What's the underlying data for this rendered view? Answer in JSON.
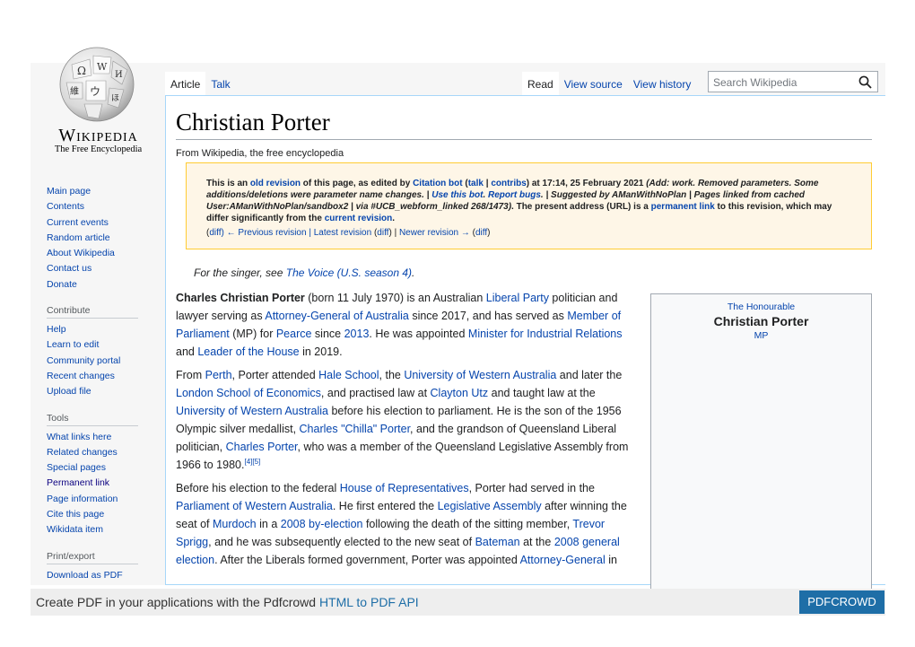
{
  "logo": {
    "wordmark": "Wikipedia",
    "tagline": "The Free Encyclopedia"
  },
  "tabs_left": [
    {
      "label": "Article",
      "selected": true
    },
    {
      "label": "Talk",
      "selected": false
    }
  ],
  "tabs_right": [
    {
      "label": "Read",
      "selected": true
    },
    {
      "label": "View source",
      "selected": false
    },
    {
      "label": "View history",
      "selected": false
    }
  ],
  "search": {
    "placeholder": "Search Wikipedia",
    "icon": "search-icon"
  },
  "title": "Christian Porter",
  "from": "From Wikipedia, the free encyclopedia",
  "notice": {
    "p1": "This is an ",
    "old_revision": "old revision",
    "p2": " of this page, as edited by ",
    "editor": "Citation bot",
    "p3": " (",
    "talk": "talk",
    "sep": " | ",
    "contribs": "contribs",
    "p4": ") at 17:14, 25 February 2021 ",
    "summary1": "(Add: work. Removed parameters. Some additions/deletions were parameter name changes. | ",
    "use_bot": "Use this bot",
    "dot": ". ",
    "report_bugs": "Report bugs",
    "summary2": ". | Suggested by AManWithNoPlan | Pages linked from cached User:AManWithNoPlan/sandbox2 | via #UCB_webform_linked 268/1473)",
    "p5": ". The present address (URL) is a ",
    "permanent_link": "permanent link",
    "p6": " to this revision, which may differ significantly from the ",
    "current_revision": "current revision",
    "p7": ".",
    "nav": {
      "paren_open": "(",
      "diff": "diff",
      "prev": ") ← Previous revision | ",
      "latest": "Latest revision",
      "paren_open2": " (",
      "diff2": "diff",
      "newer_sep": ") | ",
      "newer": "Newer revision →",
      "paren_open3": " (",
      "diff3": "diff",
      "paren_close": ")"
    }
  },
  "hatnote": {
    "pre": "For the singer, see ",
    "link": "The Voice (U.S. season 4)",
    "post": "."
  },
  "paragraphs": {
    "p1": {
      "bold": "Charles Christian Porter",
      "t1": " (born 11 July 1970) is an Australian ",
      "l1": "Liberal Party",
      "t2": " politician and lawyer serving as ",
      "l2": "Attorney-General of Australia",
      "t3": " since 2017, and has served as ",
      "l3": "Member of Parliament",
      "t4": " (MP) for ",
      "l4": "Pearce",
      "t5": " since ",
      "l5": "2013",
      "t6": ". He was appointed ",
      "l6": "Minister for Industrial Relations",
      "t7": " and ",
      "l7": "Leader of the House",
      "t8": " in 2019."
    },
    "p2": {
      "t1": "From ",
      "l1": "Perth",
      "t2": ", Porter attended ",
      "l2": "Hale School",
      "t3": ", the ",
      "l3": "University of Western Australia",
      "t4": " and later the ",
      "l4": "London School of Economics",
      "t5": ", and practised law at ",
      "l5": "Clayton Utz",
      "t6": " and taught law at the ",
      "l6": "University of Western Australia",
      "t7": " before his election to parliament. He is the son of the 1956 Olympic silver medallist, ",
      "l7": "Charles \"Chilla\" Porter",
      "t8": ", and the grandson of Queensland Liberal politician, ",
      "l8": "Charles Porter",
      "t9": ", who was a member of the Queensland Legislative Assembly from 1966 to 1980.",
      "ref": "[4][5]"
    },
    "p3": {
      "t1": "Before his election to the federal ",
      "l1": "House of Representatives",
      "t2": ", Porter had served in the ",
      "l2": "Parliament of Western Australia",
      "t3": ". He first entered the ",
      "l3": "Legislative Assembly",
      "t4": " after winning the seat of ",
      "l4": "Murdoch",
      "t5": " in a ",
      "l5": "2008 by-election",
      "t6": " following the death of the sitting member, ",
      "l6": "Trevor Sprigg",
      "t7": ", and he was subsequently elected to the new seat of ",
      "l7": "Bateman",
      "t8": " at the ",
      "l8": "2008 general election",
      "t9": ". After the Liberals formed government, Porter was appointed ",
      "l9": "Attorney-General",
      "t10": " in"
    }
  },
  "infobox": {
    "honorific": "The Honourable",
    "name": "Christian Porter",
    "post": "MP"
  },
  "sidebar": {
    "nav": [
      "Main page",
      "Contents",
      "Current events",
      "Random article",
      "About Wikipedia",
      "Contact us",
      "Donate"
    ],
    "contribute_heading": "Contribute",
    "contribute": [
      "Help",
      "Learn to edit",
      "Community portal",
      "Recent changes",
      "Upload file"
    ],
    "tools_heading": "Tools",
    "tools": [
      "What links here",
      "Related changes",
      "Special pages",
      "Permanent link",
      "Page information",
      "Cite this page",
      "Wikidata item"
    ],
    "print_heading": "Print/export",
    "print": [
      "Download as PDF"
    ]
  },
  "footer": {
    "pre": "Create PDF in your applications with the Pdfcrowd ",
    "link": "HTML to PDF API",
    "button": "PDFCROWD"
  },
  "colors": {
    "link": "#0645ad",
    "notice_bg": "#fef6e7",
    "notice_border": "#ffcc33",
    "pdf_button": "#1e6ea7"
  }
}
